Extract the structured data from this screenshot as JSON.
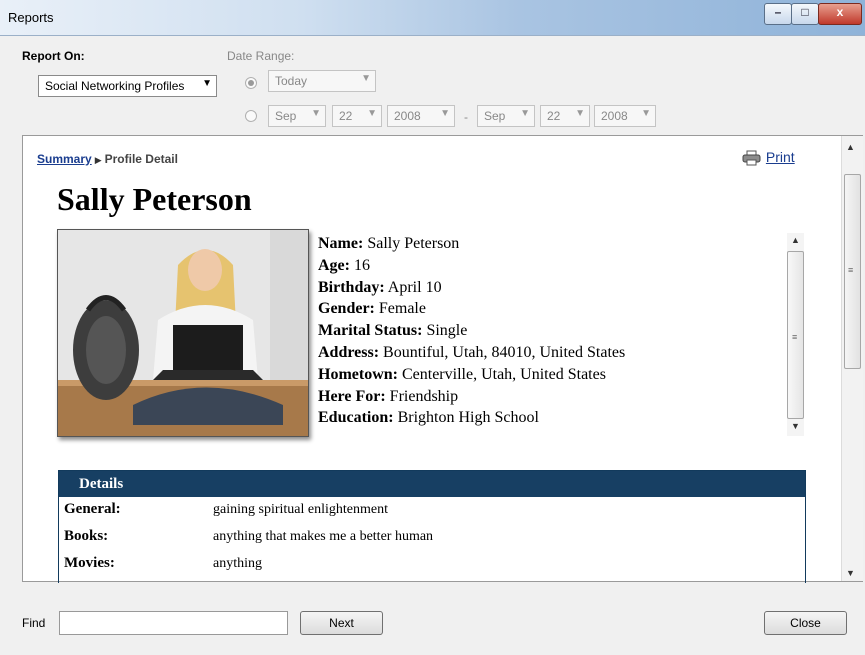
{
  "window": {
    "title": "Reports",
    "controls": {
      "minimize": "–",
      "maximize": "□",
      "close": "x"
    }
  },
  "filters": {
    "report_on_label": "Report On:",
    "report_on_value": "Social Networking Profiles",
    "date_range_label": "Date Range:",
    "preset_value": "Today",
    "from": {
      "month": "Sep",
      "day": "22",
      "year": "2008"
    },
    "separator": "-",
    "to": {
      "month": "Sep",
      "day": "22",
      "year": "2008"
    }
  },
  "report": {
    "breadcrumb": {
      "summary_link": "Summary",
      "arrow": "▶",
      "current": "Profile Detail"
    },
    "print_label": "Print",
    "profile_name": "Sally Peterson",
    "fields": [
      {
        "label": "Name:",
        "value": "Sally Peterson"
      },
      {
        "label": "Age:",
        "value": "16"
      },
      {
        "label": "Birthday:",
        "value": "April 10"
      },
      {
        "label": "Gender:",
        "value": "Female"
      },
      {
        "label": "Marital Status:",
        "value": "Single"
      },
      {
        "label": "Address:",
        "value": "Bountiful, Utah, 84010, United States"
      },
      {
        "label": "Hometown:",
        "value": "Centerville, Utah, United States"
      },
      {
        "label": "Here For:",
        "value": "Friendship"
      },
      {
        "label": "Education:",
        "value": "Brighton High School"
      }
    ],
    "details": {
      "header": "Details",
      "rows": [
        {
          "label": "General:",
          "value": "gaining spiritual enlightenment"
        },
        {
          "label": "Books:",
          "value": "anything that makes me a better human"
        },
        {
          "label": "Movies:",
          "value": "anything"
        }
      ]
    }
  },
  "footer": {
    "find_label": "Find",
    "find_value": "",
    "next_label": "Next",
    "close_label": "Close"
  },
  "colors": {
    "details_header": "#173f63",
    "link": "#1a3d8f"
  },
  "icons": [
    "printer-icon",
    "dropdown-arrow-icon",
    "scroll-up-icon",
    "scroll-down-icon"
  ]
}
